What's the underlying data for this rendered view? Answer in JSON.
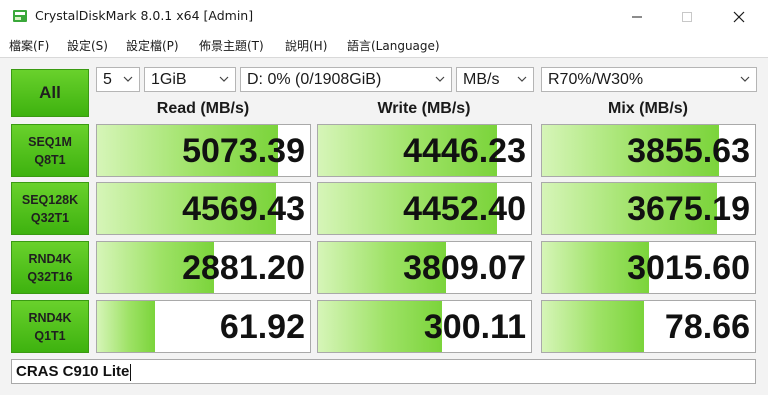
{
  "window": {
    "title": "CrystalDiskMark 8.0.1 x64 [Admin]",
    "icon": "crystaldiskmark-app-icon",
    "controls": {
      "minimize": "minimize-icon",
      "maximize": "maximize-icon",
      "close": "close-icon"
    }
  },
  "menu": [
    {
      "label": "檔案(F)"
    },
    {
      "label": "設定(S)"
    },
    {
      "label": "設定檔(P)"
    },
    {
      "label": "佈景主題(T)"
    },
    {
      "label": "說明(H)"
    },
    {
      "label": "語言(Language)"
    }
  ],
  "controls": {
    "all_label": "All",
    "count": "5",
    "size": "1GiB",
    "drive": "D: 0% (0/1908GiB)",
    "unit": "MB/s",
    "profile": "R70%/W30%"
  },
  "columns": {
    "read": "Read (MB/s)",
    "write": "Write (MB/s)",
    "mix": "Mix (MB/s)"
  },
  "rows": [
    {
      "line1": "SEQ1M",
      "line2": "Q8T1",
      "read": "5073.39",
      "write": "4446.23",
      "mix": "3855.63",
      "read_level": 0.85,
      "write_level": 0.84,
      "mix_level": 0.83
    },
    {
      "line1": "SEQ128K",
      "line2": "Q32T1",
      "read": "4569.43",
      "write": "4452.40",
      "mix": "3675.19",
      "read_level": 0.84,
      "write_level": 0.84,
      "mix_level": 0.82
    },
    {
      "line1": "RND4K",
      "line2": "Q32T16",
      "read": "2881.20",
      "write": "3809.07",
      "mix": "3015.60",
      "read_level": 0.55,
      "write_level": 0.6,
      "mix_level": 0.5
    },
    {
      "line1": "RND4K",
      "line2": "Q1T1",
      "read": "61.92",
      "write": "300.11",
      "mix": "78.66",
      "read_level": 0.27,
      "write_level": 0.58,
      "mix_level": 0.48
    }
  ],
  "drive_name": "CRAS C910 Lite",
  "colors": {
    "accent_green": "#3eb20f",
    "bar_green": "#7bd43b",
    "background": "#f3f3f3"
  }
}
